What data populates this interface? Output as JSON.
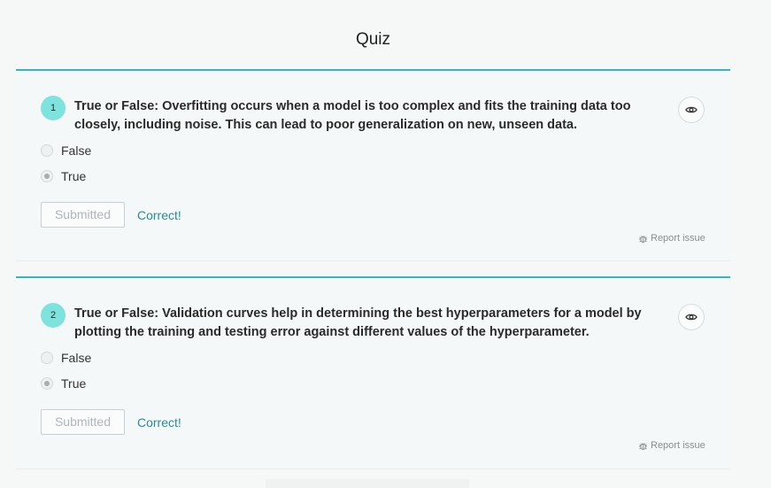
{
  "page": {
    "title": "Quiz"
  },
  "questions": [
    {
      "number": "1",
      "text": "True or False: Overfitting occurs when a model is too complex and fits the training data too closely, including noise. This can lead to poor generalization on new, unseen data.",
      "options": [
        {
          "label": "False",
          "selected": false
        },
        {
          "label": "True",
          "selected": true
        }
      ],
      "submit_label": "Submitted",
      "feedback": "Correct!",
      "report_label": "Report issue"
    },
    {
      "number": "2",
      "text": "True or False: Validation curves help in determining the best hyperparameters for a model by plotting the training and testing error against different values of the hyperparameter.",
      "options": [
        {
          "label": "False",
          "selected": false
        },
        {
          "label": "True",
          "selected": true
        }
      ],
      "submit_label": "Submitted",
      "feedback": "Correct!",
      "report_label": "Report issue"
    }
  ],
  "icons": {
    "reveal": "eye-icon",
    "report": "bug-icon"
  },
  "colors": {
    "accent": "#37b4bf",
    "badge": "#7fe3dd",
    "feedback": "#2a8a94"
  }
}
